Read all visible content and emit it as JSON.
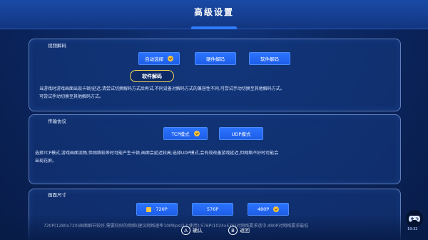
{
  "header": {
    "title": "高级设置"
  },
  "decoding": {
    "title": "视频解码",
    "options": [
      {
        "label": "自动选择",
        "selected": true
      },
      {
        "label": "硬件解码",
        "selected": false
      },
      {
        "label": "软件解码",
        "selected": false
      }
    ],
    "tooltip": "软件解码",
    "desc_line1": "当游戏时游戏画面出现卡顿/延迟,请尝试切换解码方式后再试,不同设备对解码方式的兼容性不同,可尝试手动切换至其他解码方式。",
    "desc_line2": "可尝试手动切换至其他解码方式。"
  },
  "protocol": {
    "title": "传输协议",
    "options": [
      {
        "label": "TCP模式",
        "selected": true
      },
      {
        "label": "UDP模式",
        "selected": false
      }
    ],
    "desc_line1": "选择TCP模式,游戏画面流畅,但网络较差时可能产生卡顿,画面会延迟较高;选择UDP模式,会有效改善游戏延迟,但网络不好时可能会",
    "desc_line2": "出现花屏。"
  },
  "resolution": {
    "title": "画面尺寸",
    "options": [
      {
        "label": "720P",
        "selected": false,
        "marker": true
      },
      {
        "label": "576P",
        "selected": false,
        "marker": false
      },
      {
        "label": "480P",
        "selected": true,
        "marker": false
      }
    ],
    "desc": "720P(1280x720)画面细节较好,需要较好的网络(建议网络速率10Mbps以上使用);576P(1024x576)对网络要求适中;480P对网络要求最低"
  },
  "footer": {
    "confirm_key": "A",
    "confirm_label": "确认",
    "back_key": "B",
    "back_label": "返回",
    "time": "19:32"
  },
  "colors": {
    "accent": "#2f7cff",
    "check": "#f4c542",
    "tooltip_border": "#f4d65a"
  }
}
